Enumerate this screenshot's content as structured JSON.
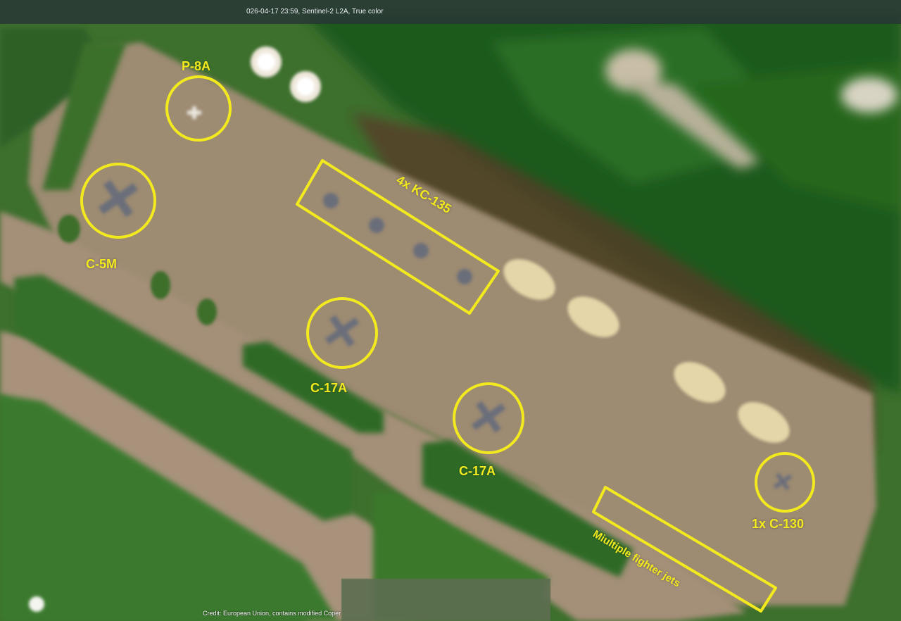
{
  "header": {
    "caption": "026-04-17 23:59, Sentinel-2 L2A, True color"
  },
  "footer": {
    "credit": "Credit: European Union, contains modified Coper"
  },
  "annotations": {
    "p8a": "P-8A",
    "c5m": "C-5M",
    "kc135": "4x KC-135",
    "c17a_1": "C-17A",
    "c17a_2": "C-17A",
    "c130": "1x C-130",
    "fighters": "Miultiple fighter jets"
  },
  "colors": {
    "annotation": "#f2ea1f",
    "grass": "#3e7a2c",
    "forest": "#1f5a1c",
    "apron": "#9c8a72"
  }
}
